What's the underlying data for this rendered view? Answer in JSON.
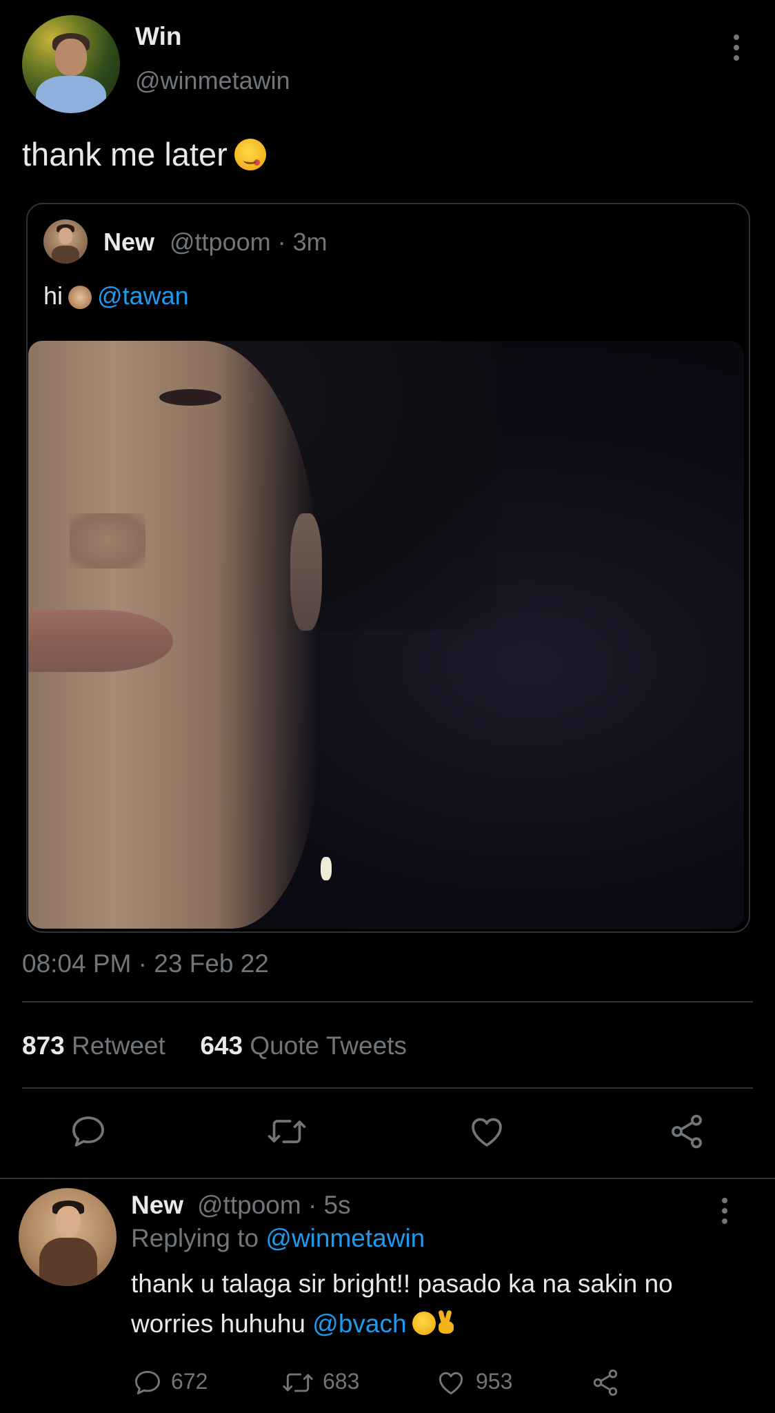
{
  "tweet": {
    "author_name": "Win",
    "author_handle": "@winmetawin",
    "text": "thank me later",
    "timestamp": "08:04 PM · 23 Feb 22"
  },
  "quoted": {
    "author_name": "New",
    "meta": "@ttpoom · 3m",
    "text_prefix": "hi",
    "mention": "@tawan"
  },
  "stats": {
    "retweets": "873",
    "retweets_label": "Retweet",
    "quotes": "643",
    "quotes_label": "Quote Tweets"
  },
  "reply": {
    "author_name": "New",
    "meta": "@ttpoom · 5s",
    "replying_label": "Replying to",
    "replying_to": "@winmetawin",
    "text": "thank u talaga sir bright!! pasado ka na sakin no worries huhuhu",
    "mention": "@bvach",
    "reply_count": "672",
    "retweet_count": "683",
    "like_count": "953"
  },
  "icons": {
    "reply": "reply-icon",
    "retweet": "retweet-icon",
    "like": "heart-icon",
    "share": "share-icon",
    "more": "more-icon"
  },
  "colors": {
    "background": "#000000",
    "text": "#e7e9ea",
    "muted": "#71767b",
    "link": "#1d9bf0",
    "divider": "#2f3336"
  }
}
